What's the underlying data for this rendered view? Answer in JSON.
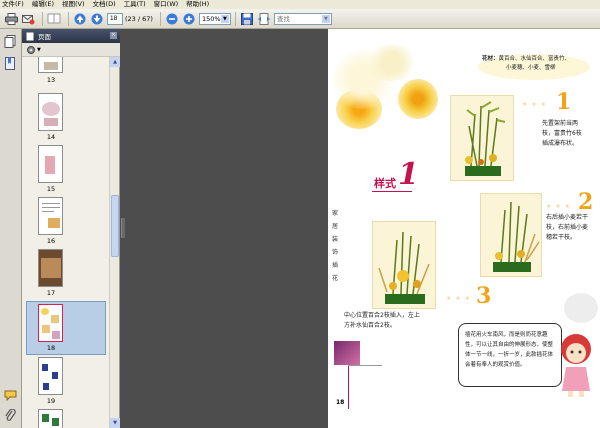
{
  "menu": {
    "items": [
      "文件(F)",
      "编辑(E)",
      "视图(V)",
      "文档(D)",
      "工具(T)",
      "窗口(W)",
      "帮助(H)"
    ]
  },
  "toolbar": {
    "page_value": "18",
    "page_count": "(23 / 67)",
    "zoom_value": "150%",
    "search_placeholder": "查找"
  },
  "panel": {
    "title": "页面",
    "close_glyph": "×"
  },
  "thumbnails": [
    {
      "label": "13",
      "selected": false
    },
    {
      "label": "14",
      "selected": false
    },
    {
      "label": "15",
      "selected": false
    },
    {
      "label": "16",
      "selected": false
    },
    {
      "label": "17",
      "selected": false
    },
    {
      "label": "18",
      "selected": true
    },
    {
      "label": "19",
      "selected": false
    },
    {
      "label": "",
      "selected": false
    }
  ],
  "document": {
    "flower_label": "花材：",
    "flower_text_1": "黄百合、水仙百合、富贵竹、",
    "flower_text_2": "小麦穗、小麦、雪柳",
    "step1_num": "1",
    "step1_text_1": "先置架前当两",
    "step1_text_2": "枝，富贵竹6枝",
    "step1_text_3": "插成瀑布状。",
    "step2_num": "2",
    "step2_text_1": "右后插小麦若干",
    "step2_text_2": "枝，右前插小麦",
    "step2_text_3": "穗若干枝。",
    "step3_num": "3",
    "step3_text_1": "中心位置百合2枝插入，左上",
    "step3_text_2": "方补水仙百合2枝。",
    "style_label": "样式",
    "style_num": "1",
    "side_text": [
      "家",
      "居",
      "装",
      "饰",
      "插",
      "花"
    ],
    "bubble_text": "插花用火车南风，而是则而花意趣性，可以让其自由的伸展形态，使整体一节一线，一折一岁，此款插花体会着有奉人的观赏价值。",
    "page_number": "18",
    "colors": {
      "accent": "#f0a418",
      "red": "#c4124e"
    }
  }
}
